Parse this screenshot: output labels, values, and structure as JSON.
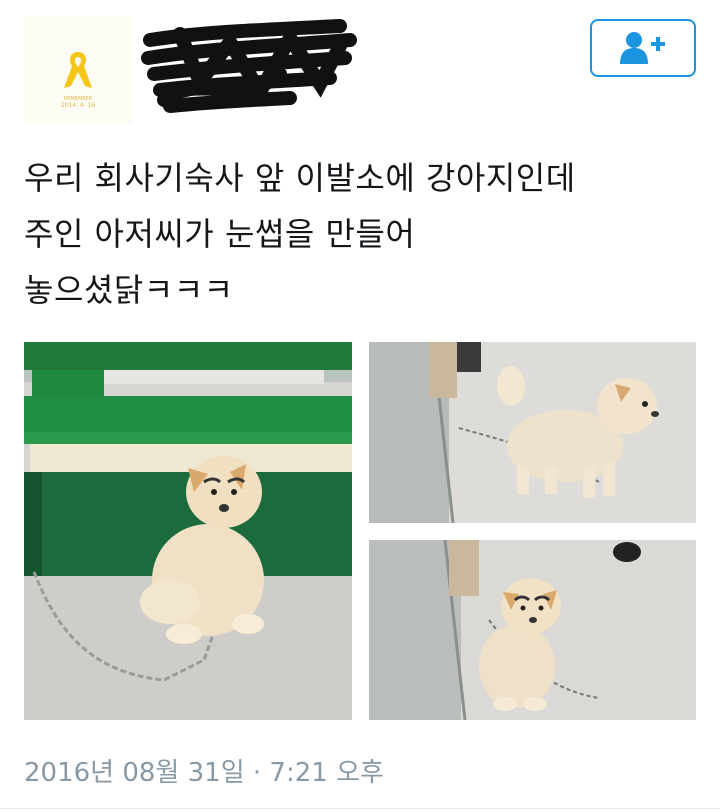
{
  "avatar": {
    "icon": "yellow-ribbon-icon",
    "caption_line1": "REMEMBER",
    "caption_line2": "2014. 4. 16",
    "ribbon_color": "#f5c518"
  },
  "header": {
    "follow_icon": "add-user-icon"
  },
  "tweet": {
    "text": "우리 회사기숙사 앞  이발소에 강아지인데\n주인 아저씨가 눈썹을 만들어\n놓으셨닭ㅋㅋㅋ",
    "timestamp": "2016년 08월 31일 · 7:21 오후"
  },
  "media": {
    "photo_count": 3
  },
  "colors": {
    "accent": "#1b95e0",
    "text": "#14171a",
    "meta": "#8899a6"
  }
}
